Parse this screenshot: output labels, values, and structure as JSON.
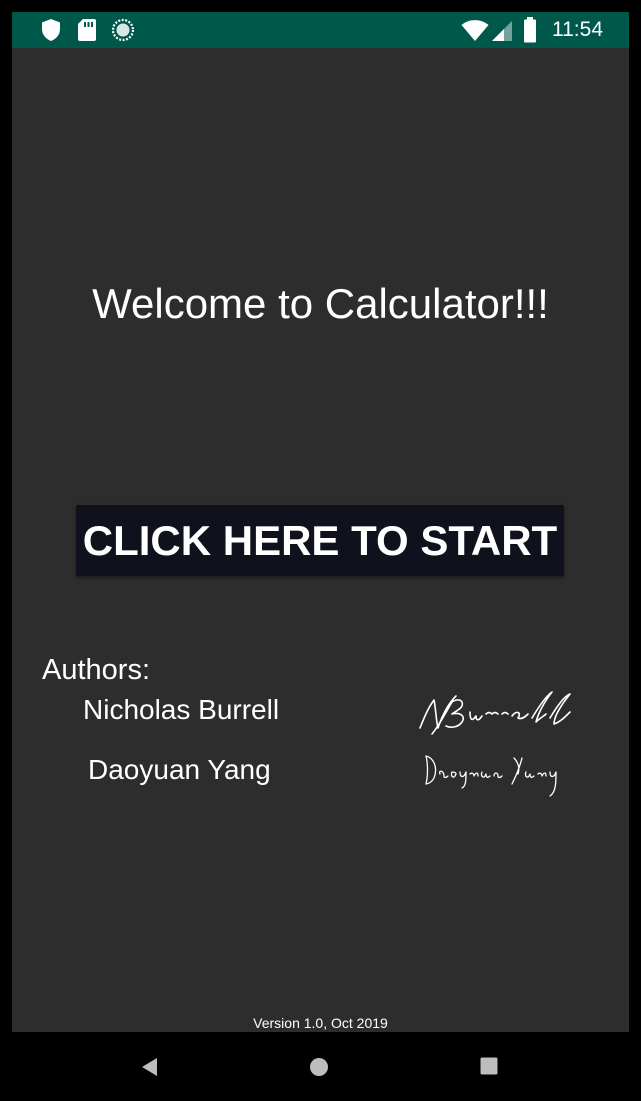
{
  "status_bar": {
    "time": "11:54",
    "left_icons": [
      "shield-icon",
      "sd-card-icon",
      "sync-circle-icon"
    ],
    "right_icons": [
      "wifi-icon",
      "signal-icon",
      "battery-icon"
    ],
    "background_color": "#00584b"
  },
  "screen": {
    "background_color": "#2d2d2d",
    "welcome_text": "Welcome to Calculator!!!",
    "start_button_label": "CLICK HERE TO START",
    "start_button_color": "#0f111c",
    "authors_label": "Authors:",
    "authors": [
      {
        "name": "Nicholas Burrell",
        "signature": "NBurrell"
      },
      {
        "name": "Daoyuan Yang",
        "signature": "Daoyuan Yang"
      }
    ],
    "version": "Version 1.0, Oct 2019"
  },
  "nav_bar": {
    "buttons": [
      "back-icon",
      "home-icon",
      "recents-icon"
    ]
  }
}
